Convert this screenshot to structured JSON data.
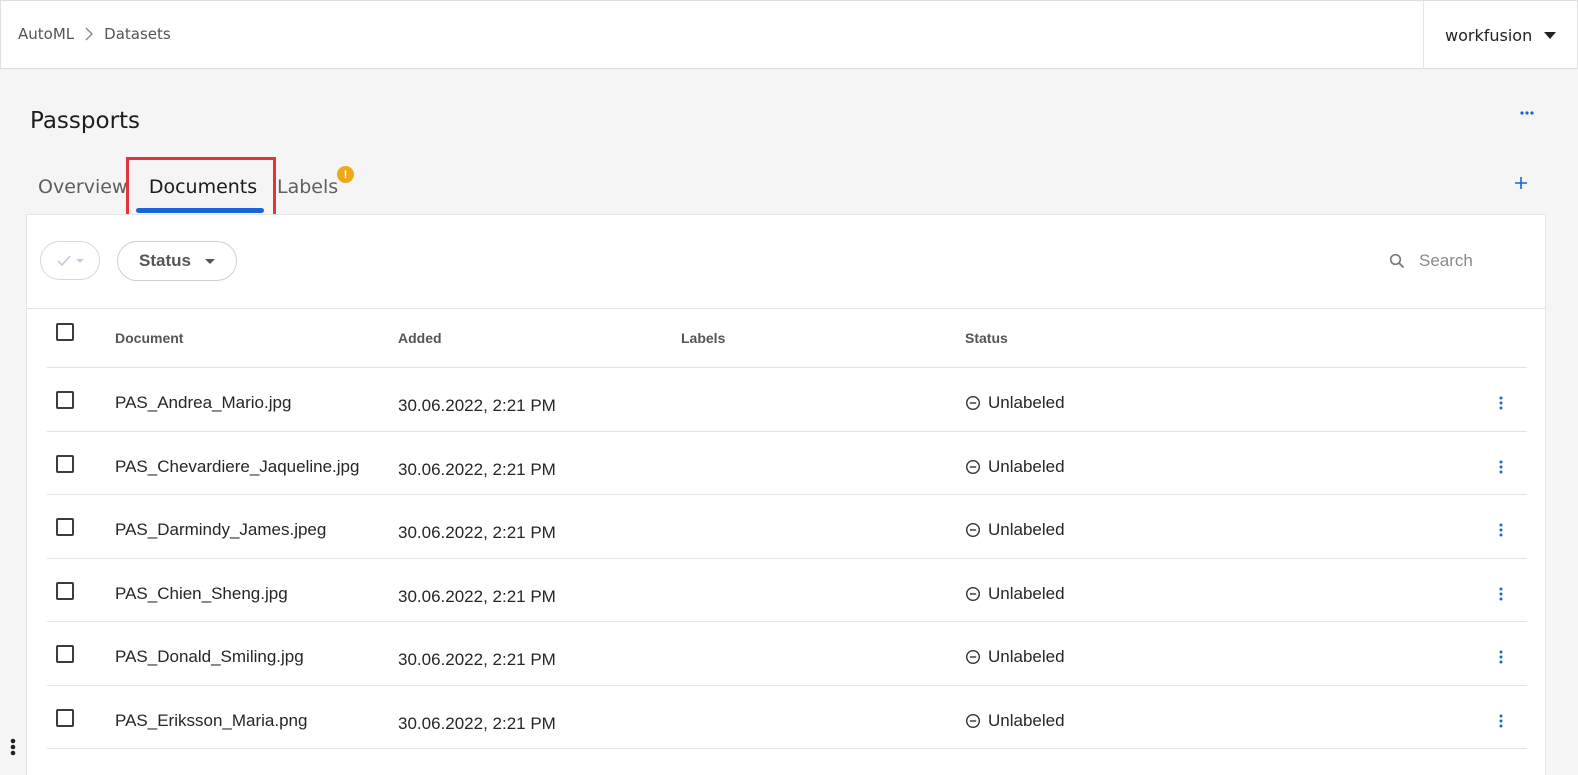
{
  "breadcrumb": {
    "items": [
      "AutoML",
      "Datasets"
    ]
  },
  "account": {
    "name": "workfusion"
  },
  "page": {
    "title": "Passports"
  },
  "tabs": {
    "overview": "Overview",
    "documents": "Documents",
    "labels": "Labels",
    "labels_badge": "!",
    "active": "Documents"
  },
  "toolbar": {
    "status_filter_label": "Status",
    "search_placeholder": "Search"
  },
  "table": {
    "columns": {
      "document": "Document",
      "added": "Added",
      "labels": "Labels",
      "status": "Status"
    },
    "rows": [
      {
        "document": "PAS_Andrea_Mario.jpg",
        "added": "30.06.2022, 2:21 PM",
        "labels": "",
        "status": "Unlabeled"
      },
      {
        "document": "PAS_Chevardiere_Jaqueline.jpg",
        "added": "30.06.2022, 2:21 PM",
        "labels": "",
        "status": "Unlabeled"
      },
      {
        "document": "PAS_Darmindy_James.jpeg",
        "added": "30.06.2022, 2:21 PM",
        "labels": "",
        "status": "Unlabeled"
      },
      {
        "document": "PAS_Chien_Sheng.jpg",
        "added": "30.06.2022, 2:21 PM",
        "labels": "",
        "status": "Unlabeled"
      },
      {
        "document": "PAS_Donald_Smiling.jpg",
        "added": "30.06.2022, 2:21 PM",
        "labels": "",
        "status": "Unlabeled"
      },
      {
        "document": "PAS_Eriksson_Maria.png",
        "added": "30.06.2022, 2:21 PM",
        "labels": "",
        "status": "Unlabeled"
      }
    ]
  },
  "colors": {
    "accent": "#1a64d8",
    "highlight": "#e3343b",
    "badge": "#f0a81b"
  },
  "icons": {
    "breadcrumb_separator": "chevron-right-icon",
    "account_caret": "caret-down-icon",
    "more_top": "horizontal-dots-icon",
    "add_tab": "plus-icon",
    "bulk_select": "check-icon",
    "search": "search-icon",
    "status": "minus-circle-icon",
    "row_menu": "vertical-dots-icon"
  }
}
